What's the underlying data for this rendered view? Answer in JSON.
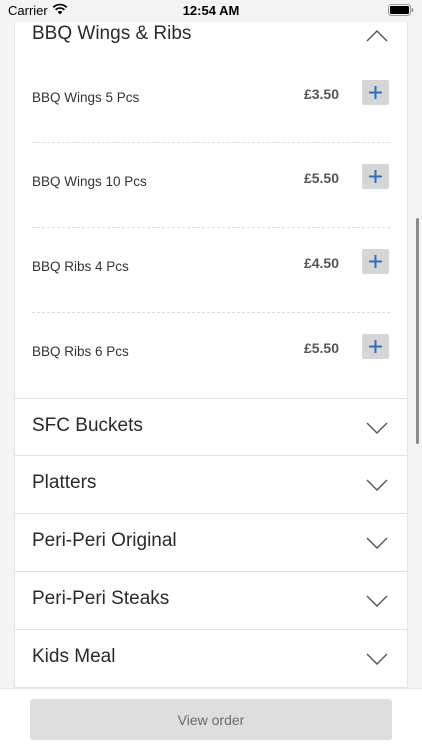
{
  "status_bar": {
    "carrier": "Carrier",
    "time": "12:54 AM"
  },
  "expanded_section": {
    "title": "BBQ Wings & Ribs",
    "items": [
      {
        "name": "BBQ Wings 5 Pcs",
        "price": "£3.50"
      },
      {
        "name": "BBQ Wings 10 Pcs",
        "price": "£5.50"
      },
      {
        "name": "BBQ Ribs 4 Pcs",
        "price": "£4.50"
      },
      {
        "name": "BBQ Ribs 6 Pcs",
        "price": "£5.50"
      }
    ]
  },
  "collapsed_sections": [
    {
      "title": "SFC Buckets"
    },
    {
      "title": "Platters"
    },
    {
      "title": "Peri-Peri Original"
    },
    {
      "title": "Peri-Peri Steaks"
    },
    {
      "title": "Kids Meal"
    }
  ],
  "footer": {
    "view_order_label": "View order"
  },
  "icons": {
    "add": "plus-icon",
    "expanded": "chevron-up-icon",
    "collapsed": "chevron-down-icon"
  },
  "colors": {
    "accent": "#2f6fbf",
    "button_disabled_bg": "#dedede"
  }
}
